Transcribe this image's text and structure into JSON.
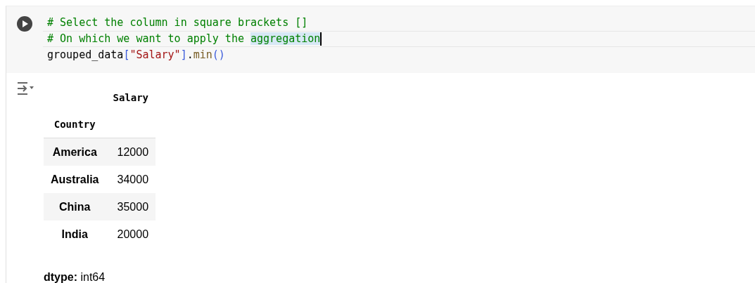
{
  "cell": {
    "code_lines": [
      {
        "cursor": false,
        "tokens": [
          {
            "kind": "comment",
            "text": "# Select the column in square brackets []",
            "highlighted": false
          }
        ]
      },
      {
        "cursor": true,
        "tokens": [
          {
            "kind": "comment",
            "text": "# On which we want to apply the ",
            "highlighted": false
          },
          {
            "kind": "comment",
            "text": "aggregation",
            "highlighted": true
          }
        ]
      },
      {
        "cursor": false,
        "tokens": [
          {
            "kind": "plain",
            "text": "grouped_data",
            "highlighted": false
          },
          {
            "kind": "bracket",
            "text": "[",
            "highlighted": false
          },
          {
            "kind": "string",
            "text": "\"Salary\"",
            "highlighted": false
          },
          {
            "kind": "bracket",
            "text": "]",
            "highlighted": false
          },
          {
            "kind": "plain",
            "text": ".",
            "highlighted": false
          },
          {
            "kind": "function",
            "text": "min",
            "highlighted": false
          },
          {
            "kind": "bracket",
            "text": "()",
            "highlighted": false
          }
        ]
      }
    ]
  },
  "output": {
    "table": {
      "column_header": "Salary",
      "index_header": "Country",
      "rows": [
        {
          "label": "America",
          "value": "12000"
        },
        {
          "label": "Australia",
          "value": "34000"
        },
        {
          "label": "China",
          "value": "35000"
        },
        {
          "label": "India",
          "value": "20000"
        }
      ]
    },
    "dtype_label": "dtype:",
    "dtype_value": "int64"
  }
}
